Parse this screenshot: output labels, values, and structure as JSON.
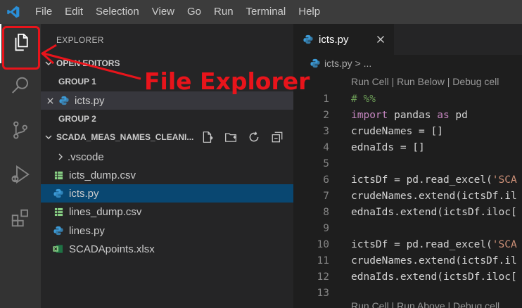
{
  "menu": [
    "File",
    "Edit",
    "Selection",
    "View",
    "Go",
    "Run",
    "Terminal",
    "Help"
  ],
  "sidebar": {
    "title": "EXPLORER",
    "open_editors_label": "OPEN EDITORS",
    "group1_label": "GROUP 1",
    "open_file": "icts.py",
    "group2_label": "GROUP 2",
    "folder_label": "SCADA_MEAS_NAMES_CLEANI...",
    "items": [
      {
        "label": ".vscode",
        "kind": "folder"
      },
      {
        "label": "icts_dump.csv",
        "kind": "csv"
      },
      {
        "label": "icts.py",
        "kind": "python",
        "selected": true
      },
      {
        "label": "lines_dump.csv",
        "kind": "csv"
      },
      {
        "label": "lines.py",
        "kind": "python"
      },
      {
        "label": "SCADApoints.xlsx",
        "kind": "excel"
      }
    ]
  },
  "editor": {
    "tab_label": "icts.py",
    "breadcrumb": "icts.py > ...",
    "codelens_top": "Run Cell | Run Below | Debug cell",
    "codelens_bottom": "Run Cell | Run Above | Debug cell",
    "lines": [
      {
        "n": "1",
        "code": "# %%"
      },
      {
        "n": "2",
        "code": "import pandas as pd"
      },
      {
        "n": "3",
        "code": "crudeNames = []"
      },
      {
        "n": "4",
        "code": "ednaIds = []"
      },
      {
        "n": "5",
        "code": ""
      },
      {
        "n": "6",
        "code": "ictsDf = pd.read_excel('SCA"
      },
      {
        "n": "7",
        "code": "crudeNames.extend(ictsDf.il"
      },
      {
        "n": "8",
        "code": "ednaIds.extend(ictsDf.iloc["
      },
      {
        "n": "9",
        "code": ""
      },
      {
        "n": "10",
        "code": "ictsDf = pd.read_excel('SCA"
      },
      {
        "n": "11",
        "code": "crudeNames.extend(ictsDf.il"
      },
      {
        "n": "12",
        "code": "ednaIds.extend(ictsDf.iloc["
      },
      {
        "n": "13",
        "code": ""
      }
    ]
  },
  "annotation": {
    "text": "File Explorer",
    "color": "#e8141b"
  },
  "colors": {
    "accent": "#007acc",
    "selection": "#094771",
    "python": "#3c9ad6",
    "excel_csv": "#89d185"
  }
}
